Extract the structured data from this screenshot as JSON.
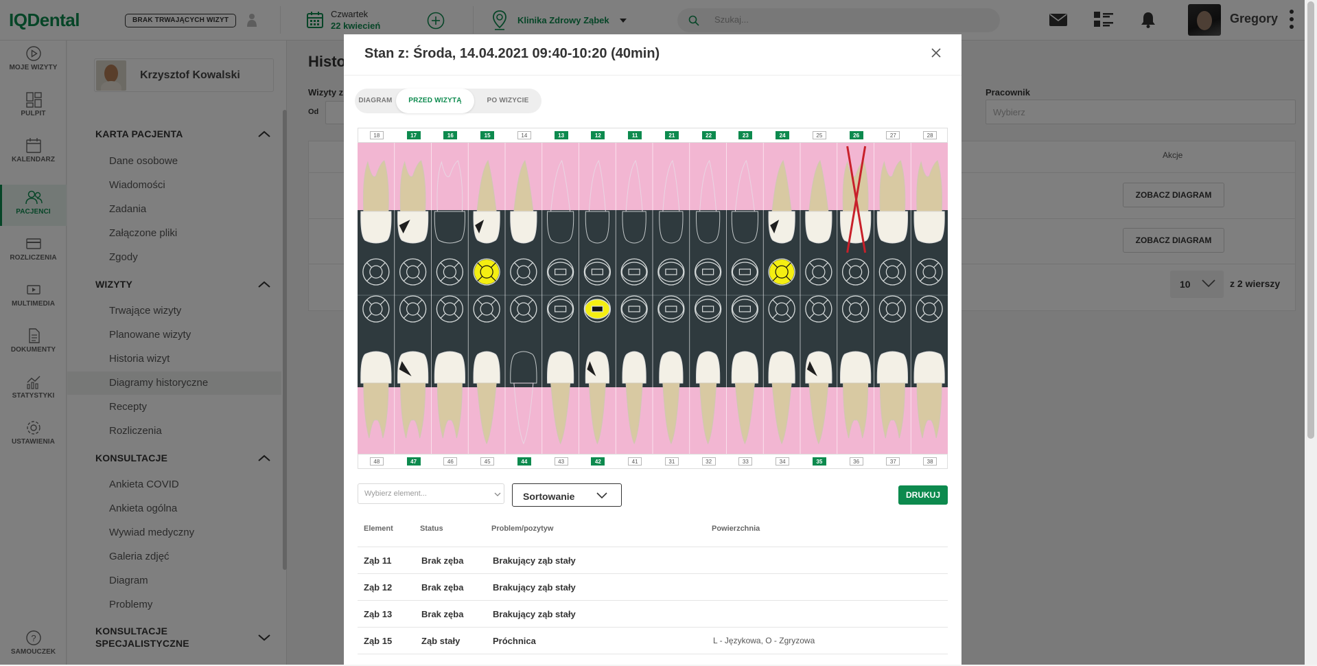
{
  "header": {
    "logo_part1": "IQ",
    "logo_part2": "Dental",
    "no_visits_button": "BRAK TRWAJĄCYCH WIZYT",
    "day_name": "Czwartek",
    "date_label": "22 kwiecień",
    "clinic_name": "Klinika Zdrowy Ząbek",
    "search_placeholder": "Szukaj...",
    "user_name": "Gregory"
  },
  "rail": {
    "items": [
      {
        "label": "MOJE WIZYTY",
        "icon": "play-circle-icon"
      },
      {
        "label": "PULPIT",
        "icon": "dashboard-icon"
      },
      {
        "label": "KALENDARZ",
        "icon": "calendar-icon"
      },
      {
        "label": "PACJENCI",
        "icon": "patients-icon"
      },
      {
        "label": "ROZLICZENIA",
        "icon": "card-icon"
      },
      {
        "label": "MULTIMEDIA",
        "icon": "multimedia-icon"
      },
      {
        "label": "DOKUMENTY",
        "icon": "document-icon"
      },
      {
        "label": "STATYSTYKI",
        "icon": "stats-icon"
      },
      {
        "label": "USTAWIENIA",
        "icon": "settings-icon"
      },
      {
        "label": "SAMOUCZEK",
        "icon": "help-icon"
      }
    ],
    "accent": "#0d8a4e"
  },
  "subnav": {
    "patient_name": "Krzysztof Kowalski",
    "sections": [
      {
        "title": "KARTA PACJENTA",
        "items": [
          "Dane osobowe",
          "Wiadomości",
          "Zadania",
          "Załączone pliki",
          "Zgody"
        ]
      },
      {
        "title": "WIZYTY",
        "items": [
          "Trwające wizyty",
          "Planowane wizyty",
          "Historia wizyt",
          "Diagramy historyczne",
          "Recepty",
          "Rozliczenia"
        ]
      },
      {
        "title": "KONSULTACJE",
        "items": [
          "Ankieta COVID",
          "Ankieta ogólna",
          "Wywiad medyczny",
          "Galeria zdjęć",
          "Diagram",
          "Problemy"
        ]
      },
      {
        "title_line1": "KONSULTACJE",
        "title_line2": "SPECJALISTYCZNE"
      }
    ]
  },
  "background_page": {
    "title": "Histo",
    "visits_label": "Wizyty z",
    "from_label": "Od",
    "employee_label": "Pracownik",
    "employee_placeholder": "Wybierz",
    "actions_header": "Akcje",
    "view_diagram_button": "ZOBACZ DIAGRAM",
    "rows_per_page": "10",
    "rows_of": "z 2 wierszy"
  },
  "modal": {
    "title": "Stan z: Środa, 14.04.2021 09:40-10:20 (40min)",
    "tabs": [
      "DIAGRAM",
      "PRZED WIZYTĄ",
      "PO WIZYCIE"
    ],
    "active_tab": "PRZED WIZYTĄ",
    "element_placeholder": "Wybierz element...",
    "sort_label": "Sortowanie",
    "print_button": "DRUKUJ",
    "table_headers": [
      "Element",
      "Status",
      "Problem/pozytyw",
      "Powierzchnia"
    ],
    "rows": [
      {
        "element": "Ząb 11",
        "status": "Brak zęba",
        "problem": "Brakujący ząb stały",
        "surface": ""
      },
      {
        "element": "Ząb 12",
        "status": "Brak zęba",
        "problem": "Brakujący ząb stały",
        "surface": ""
      },
      {
        "element": "Ząb 13",
        "status": "Brak zęba",
        "problem": "Brakujący ząb stały",
        "surface": ""
      },
      {
        "element": "Ząb 15",
        "status": "Ząb stały",
        "problem": "Próchnica",
        "surface": "L - Językowa, O - Zgryzowa"
      }
    ]
  },
  "dental_chart": {
    "upper_teeth": [
      {
        "num": "18",
        "highlight": false,
        "type": "molar",
        "present": true,
        "caries": false
      },
      {
        "num": "17",
        "highlight": true,
        "type": "molar",
        "present": true,
        "caries": true
      },
      {
        "num": "16",
        "highlight": true,
        "type": "molar",
        "present": false,
        "caries": false
      },
      {
        "num": "15",
        "highlight": true,
        "type": "premolar",
        "present": true,
        "caries": true,
        "yellow": true
      },
      {
        "num": "14",
        "highlight": false,
        "type": "premolar",
        "present": true,
        "caries": false
      },
      {
        "num": "13",
        "highlight": true,
        "type": "canine",
        "present": false,
        "caries": false
      },
      {
        "num": "12",
        "highlight": true,
        "type": "incisor",
        "present": false,
        "caries": false
      },
      {
        "num": "11",
        "highlight": true,
        "type": "incisor",
        "present": false,
        "caries": false
      },
      {
        "num": "21",
        "highlight": true,
        "type": "incisor",
        "present": false,
        "caries": false
      },
      {
        "num": "22",
        "highlight": true,
        "type": "incisor",
        "present": false,
        "caries": false
      },
      {
        "num": "23",
        "highlight": true,
        "type": "canine",
        "present": false,
        "caries": false
      },
      {
        "num": "24",
        "highlight": true,
        "type": "premolar",
        "present": true,
        "caries": true,
        "yellow": true
      },
      {
        "num": "25",
        "highlight": false,
        "type": "premolar",
        "present": true,
        "caries": false
      },
      {
        "num": "26",
        "highlight": true,
        "type": "molar",
        "present": true,
        "caries": false,
        "crossed": true
      },
      {
        "num": "27",
        "highlight": false,
        "type": "molar",
        "present": true,
        "caries": false
      },
      {
        "num": "28",
        "highlight": false,
        "type": "molar",
        "present": true,
        "caries": false
      }
    ],
    "lower_teeth": [
      {
        "num": "48",
        "highlight": false,
        "type": "molar",
        "present": true,
        "caries": false
      },
      {
        "num": "47",
        "highlight": true,
        "type": "molar",
        "present": true,
        "caries": true
      },
      {
        "num": "46",
        "highlight": false,
        "type": "molar",
        "present": true,
        "caries": false
      },
      {
        "num": "45",
        "highlight": false,
        "type": "premolar",
        "present": true,
        "caries": false
      },
      {
        "num": "44",
        "highlight": true,
        "type": "premolar",
        "present": false,
        "caries": false
      },
      {
        "num": "43",
        "highlight": false,
        "type": "canine",
        "present": true,
        "caries": false
      },
      {
        "num": "42",
        "highlight": true,
        "type": "incisor",
        "present": true,
        "caries": true,
        "yellow": true
      },
      {
        "num": "41",
        "highlight": false,
        "type": "incisor",
        "present": true,
        "caries": false
      },
      {
        "num": "31",
        "highlight": false,
        "type": "incisor",
        "present": true,
        "caries": false
      },
      {
        "num": "32",
        "highlight": false,
        "type": "incisor",
        "present": true,
        "caries": false
      },
      {
        "num": "33",
        "highlight": false,
        "type": "canine",
        "present": true,
        "caries": false
      },
      {
        "num": "34",
        "highlight": false,
        "type": "premolar",
        "present": true,
        "caries": false
      },
      {
        "num": "35",
        "highlight": true,
        "type": "premolar",
        "present": true,
        "caries": true
      },
      {
        "num": "36",
        "highlight": false,
        "type": "molar",
        "present": true,
        "caries": false
      },
      {
        "num": "37",
        "highlight": false,
        "type": "molar",
        "present": true,
        "caries": false
      },
      {
        "num": "38",
        "highlight": false,
        "type": "molar",
        "present": true,
        "caries": false
      }
    ],
    "colors": {
      "gum": "#f2b6d2",
      "dark": "#2f3a3e",
      "tooth": "#f3f0e6",
      "root": "#d8c9a2",
      "yellow": "#f4ee12",
      "cross": "#c8202a"
    }
  }
}
